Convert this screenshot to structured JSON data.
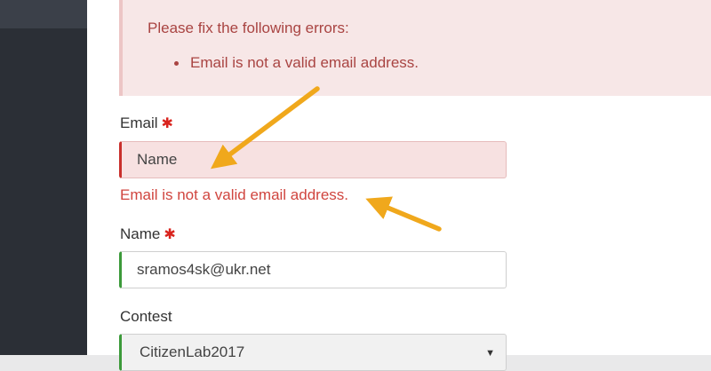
{
  "alert": {
    "title": "Please fix the following errors:",
    "items": [
      "Email is not a valid email address."
    ]
  },
  "form": {
    "email": {
      "label": "Email",
      "required_mark": "✱",
      "value": "Name",
      "error": "Email is not a valid email address."
    },
    "name": {
      "label": "Name",
      "required_mark": "✱",
      "value": "sramos4sk@ukr.net"
    },
    "contest": {
      "label": "Contest",
      "selected": "CitizenLab2017",
      "caret": "▼"
    }
  },
  "colors": {
    "error_text": "#a94442",
    "error_border": "#c9302c",
    "valid_border": "#3c9a3a",
    "annotation_arrow": "#f0a81c"
  }
}
